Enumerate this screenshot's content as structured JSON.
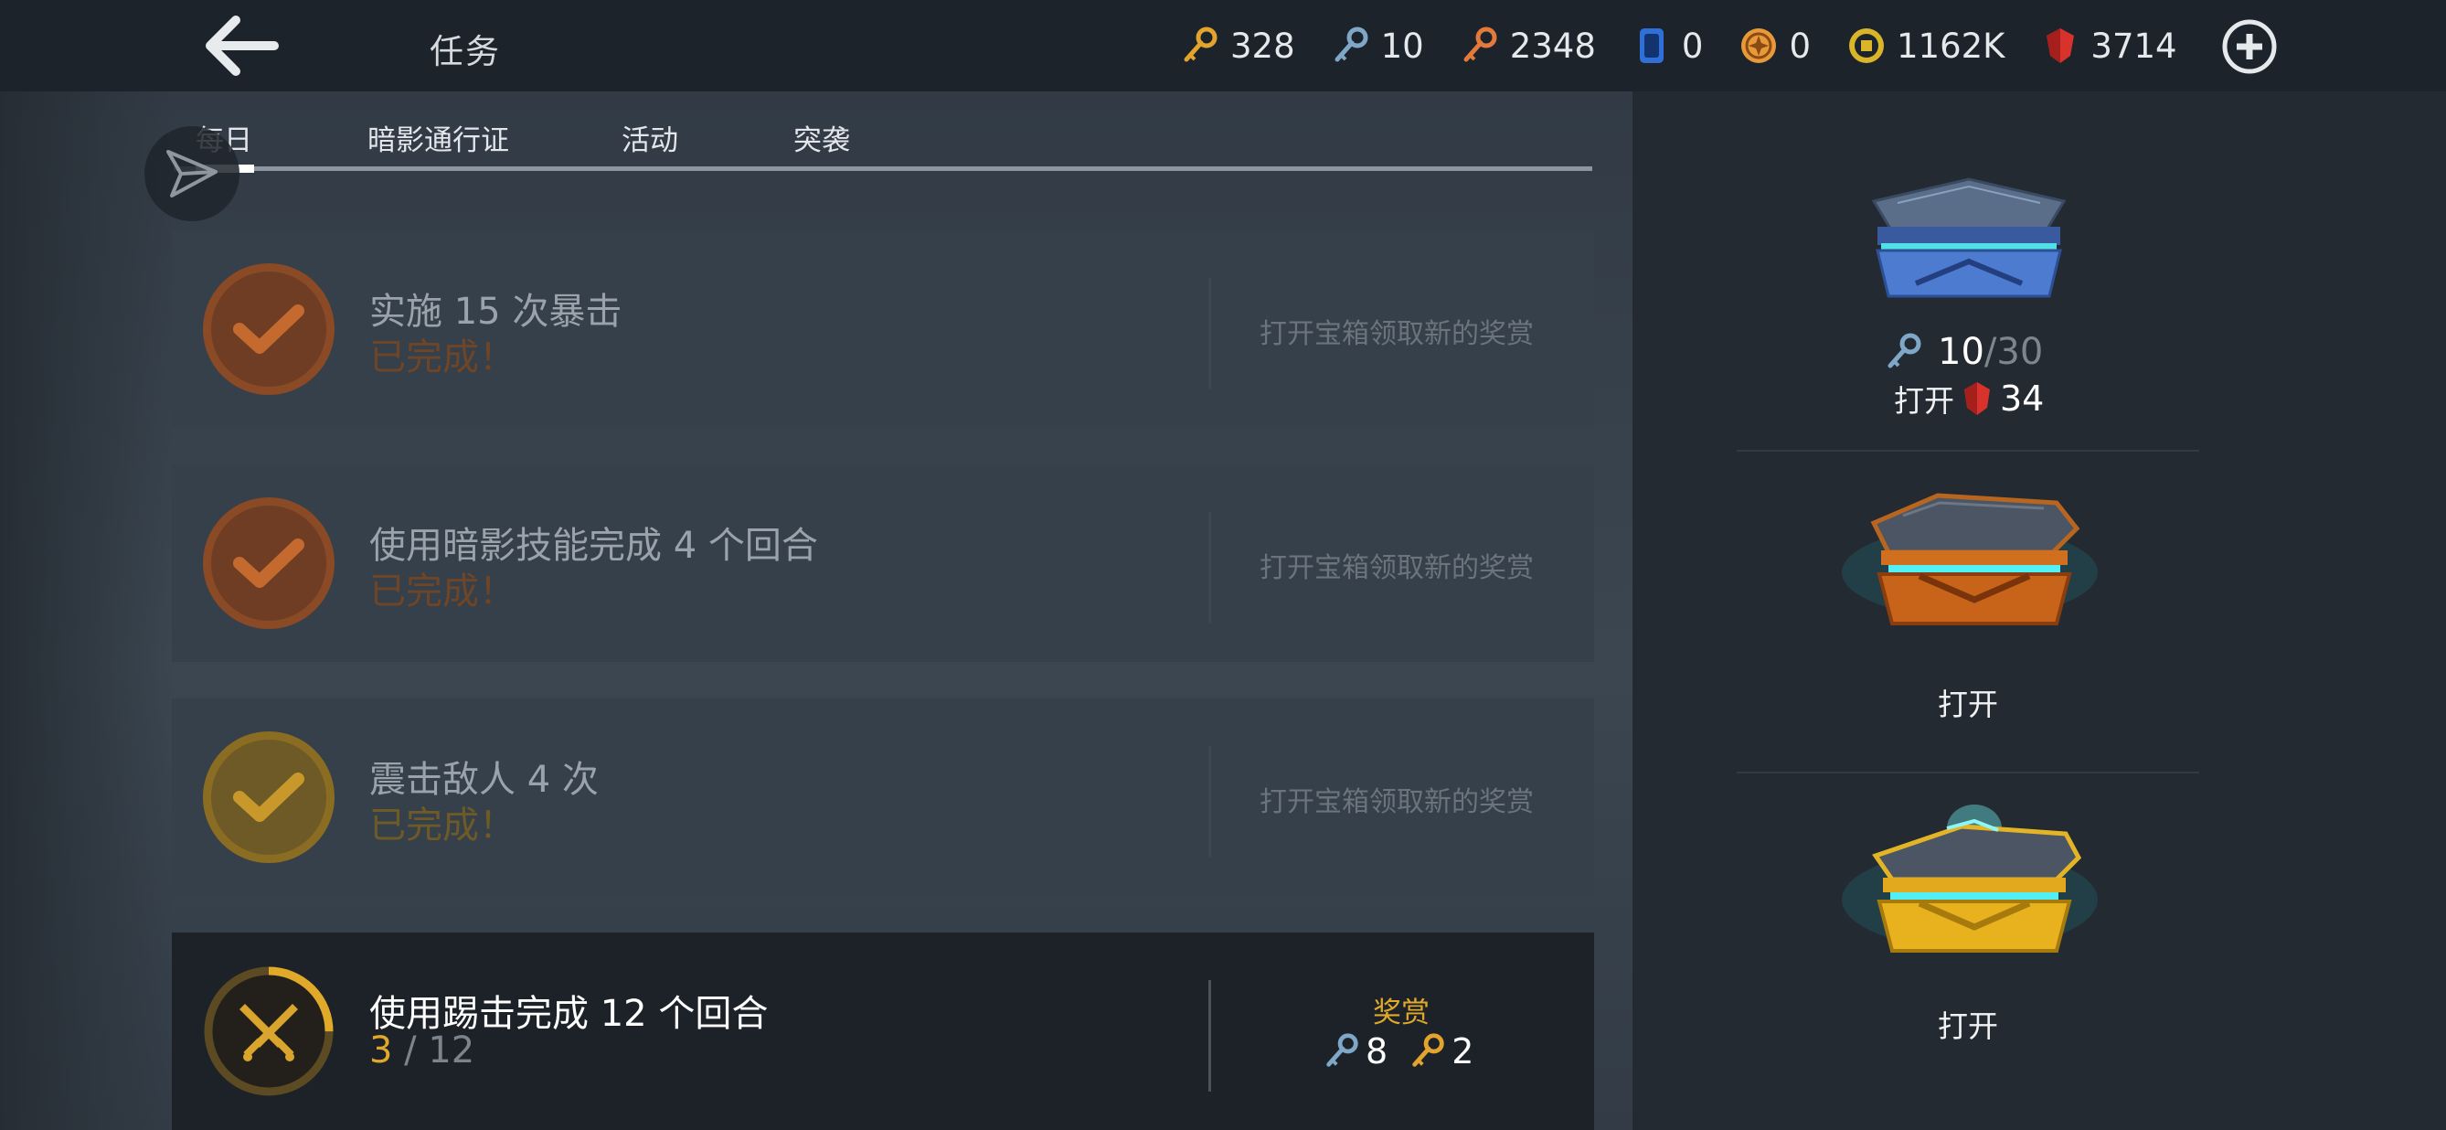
{
  "header": {
    "title": "任务",
    "currencies": [
      {
        "icon": "gold-key-icon",
        "value": "328",
        "color": "#e2a42c"
      },
      {
        "icon": "silver-key-icon",
        "value": "10",
        "color": "#7fa8c8"
      },
      {
        "icon": "bronze-key-icon",
        "value": "2348",
        "color": "#e27a3c"
      },
      {
        "icon": "card-icon",
        "value": "0",
        "color": "#2f6fd8"
      },
      {
        "icon": "token-icon",
        "value": "0",
        "color": "#e89a3a"
      },
      {
        "icon": "coin-icon",
        "value": "1162K",
        "color": "#d9b52a"
      },
      {
        "icon": "ruby-icon",
        "value": "3714",
        "color": "#d8322c"
      }
    ]
  },
  "tabs": [
    {
      "label": "每日",
      "active": true
    },
    {
      "label": "暗影通行证",
      "active": false
    },
    {
      "label": "活动",
      "active": false
    },
    {
      "label": "突袭",
      "active": false
    }
  ],
  "tasks": [
    {
      "title": "实施 15 次暴击",
      "status": "已完成！",
      "hint": "打开宝箱领取新的奖赏",
      "accent": "#c46a2e"
    },
    {
      "title": "使用暗影技能完成 4 个回合",
      "status": "已完成！",
      "hint": "打开宝箱领取新的奖赏",
      "accent": "#c46a2e"
    },
    {
      "title": "震击敌人 4 次",
      "status": "已完成！",
      "hint": "打开宝箱领取新的奖赏",
      "accent": "#c9982a"
    },
    {
      "title": "使用踢击完成 12 个回合",
      "progress_current": "3",
      "progress_sep": " / ",
      "progress_total": "12",
      "progress_fraction": 0.25,
      "reward_label": "奖赏",
      "rewards": [
        {
          "icon": "silver-key-icon",
          "value": "8"
        },
        {
          "icon": "gold-key-icon",
          "value": "2"
        }
      ]
    }
  ],
  "chests": {
    "silver": {
      "key_have": "10",
      "key_sep": " / ",
      "key_need": "30",
      "open_label": "打开",
      "gem_cost": "34"
    },
    "bronze": {
      "open_label": "打开"
    },
    "gold": {
      "open_label": "打开"
    }
  }
}
